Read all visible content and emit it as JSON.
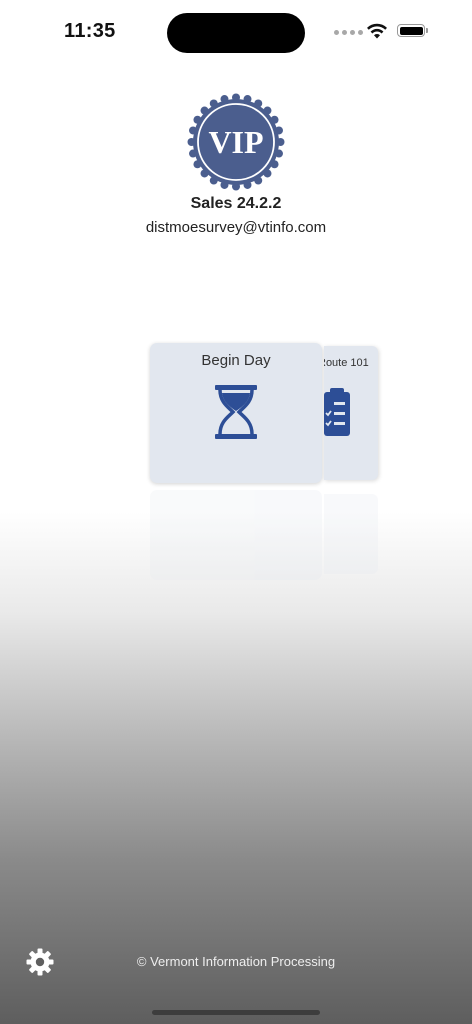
{
  "status_bar": {
    "time": "11:35"
  },
  "header": {
    "logo_text": "VIP",
    "app_version": "Sales 24.2.2",
    "user_email": "distmoesurvey@vtinfo.com"
  },
  "carousel": {
    "items": [
      {
        "label": "Begin Day",
        "icon": "hourglass-icon"
      },
      {
        "label": "Route 101",
        "icon": "clipboard-checklist-icon"
      }
    ]
  },
  "footer": {
    "settings_icon": "gear-icon",
    "copyright": "© Vermont Information Processing"
  },
  "colors": {
    "accent": "#2d4e96",
    "logo": "#4b5e8e",
    "card": "#e2e7ef"
  }
}
